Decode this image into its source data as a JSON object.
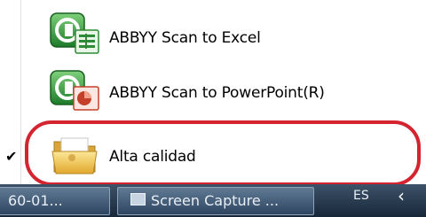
{
  "menu": {
    "items": [
      {
        "label": "ABBYY Scan to Excel",
        "icon": "abbyy-excel-icon",
        "checked": false
      },
      {
        "label": "ABBYY Scan to PowerPoint(R)",
        "icon": "abbyy-powerpoint-icon",
        "checked": false
      },
      {
        "label": "Alta calidad",
        "icon": "folder-icon",
        "checked": true
      }
    ],
    "check_glyph": "✔"
  },
  "taskbar": {
    "buttons": [
      {
        "label": "60-01..."
      },
      {
        "label": "Screen Capture ..."
      }
    ],
    "language": "ES",
    "tray_arrow": "‹"
  },
  "colors": {
    "highlight": "#d32430",
    "excel_green": "#2e8b35",
    "ppt_red": "#c4402a",
    "folder_yellow": "#f2c84b"
  }
}
